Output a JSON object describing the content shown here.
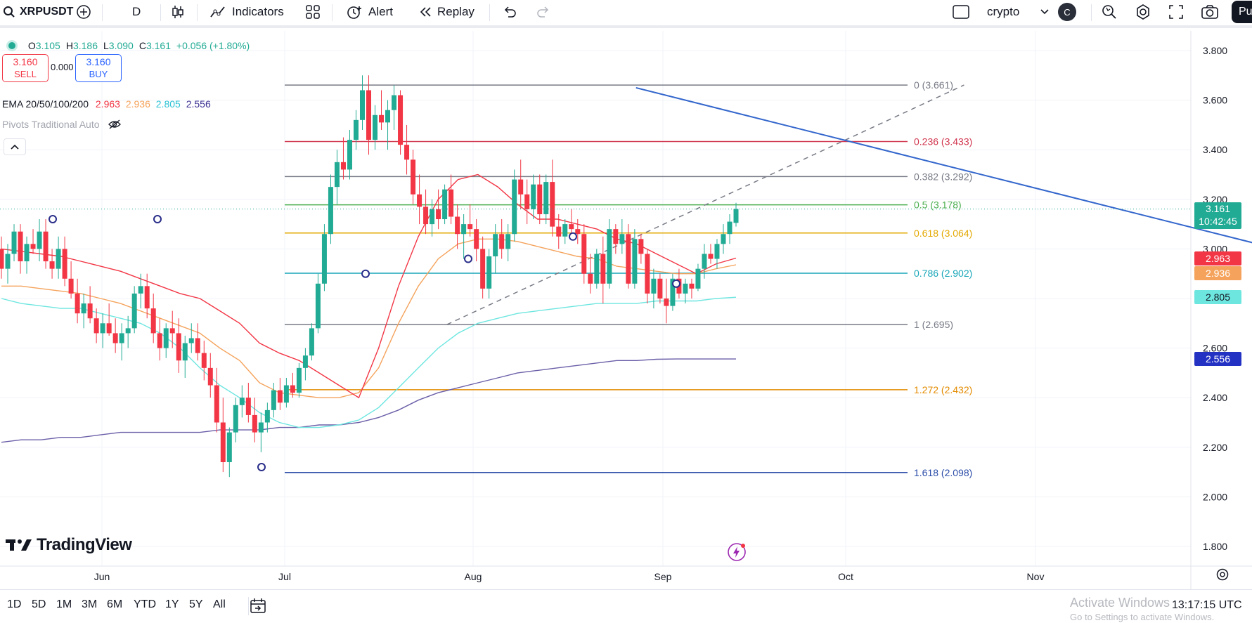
{
  "toolbar": {
    "symbol": "XRPUSDT",
    "interval": "D",
    "indicators_label": "Indicators",
    "alert_label": "Alert",
    "replay_label": "Replay",
    "watchlist": "crypto",
    "avatar_letter": "C",
    "publish_label": "Pu"
  },
  "legend": {
    "ohlc": [
      {
        "key": "O",
        "value": "3.105"
      },
      {
        "key": "H",
        "value": "3.186"
      },
      {
        "key": "L",
        "value": "3.090"
      },
      {
        "key": "C",
        "value": "3.161"
      }
    ],
    "change": "+0.056 (+1.80%)",
    "sell_price": "3.160",
    "sell_label": "SELL",
    "spread": "0.000",
    "buy_price": "3.160",
    "buy_label": "BUY",
    "ema_label": "EMA 20/50/100/200",
    "ema_values": [
      "2.963",
      "2.936",
      "2.805",
      "2.556"
    ],
    "pivots_label": "Pivots Traditional Auto"
  },
  "colors": {
    "up": "#22ab94",
    "down": "#f23645",
    "ema20": "#f23645",
    "ema50": "#f5a35c",
    "ema100": "#6ee6e0",
    "ema200": "#6b5fa8",
    "trend": "#3366cc"
  },
  "price_axis": {
    "ticks": [
      "3.800",
      "3.600",
      "3.400",
      "3.200",
      "3.000",
      "2.800",
      "2.600",
      "2.400",
      "2.200",
      "2.000",
      "1.800"
    ],
    "last_price": "3.161",
    "countdown": "10:42:45",
    "ema_tags": [
      "2.963",
      "2.936",
      "2.805",
      "2.556"
    ]
  },
  "time_axis": [
    "Jun",
    "Jul",
    "Aug",
    "Sep",
    "Oct",
    "Nov"
  ],
  "fib_levels": [
    {
      "label": "0 (3.661)",
      "price": 3.661,
      "color": "#787b86"
    },
    {
      "label": "0.236 (3.433)",
      "price": 3.433,
      "color": "#d1364f"
    },
    {
      "label": "0.382 (3.292)",
      "price": 3.292,
      "color": "#787b86"
    },
    {
      "label": "0.5 (3.178)",
      "price": 3.178,
      "color": "#4caf50"
    },
    {
      "label": "0.618 (3.064)",
      "price": 3.064,
      "color": "#e3a800"
    },
    {
      "label": "0.786 (2.902)",
      "price": 2.902,
      "color": "#18a6b8"
    },
    {
      "label": "1 (2.695)",
      "price": 2.695,
      "color": "#787b86"
    },
    {
      "label": "1.272 (2.432)",
      "price": 2.432,
      "color": "#e38b00"
    },
    {
      "label": "1.618 (2.098)",
      "price": 2.098,
      "color": "#2c4da8"
    }
  ],
  "branding": "TradingView",
  "bottom": {
    "ranges": [
      "1D",
      "5D",
      "1M",
      "3M",
      "6M",
      "YTD",
      "1Y",
      "5Y",
      "All"
    ],
    "clock": "13:17:15 UTC",
    "watermark_title": "Activate Windows",
    "watermark_sub": "Go to Settings to activate Windows."
  },
  "chart_data": {
    "type": "candlestick",
    "price_range": [
      1.75,
      3.85
    ],
    "candles": [
      [
        3.0,
        3.05,
        2.88,
        2.92
      ],
      [
        2.92,
        3.02,
        2.86,
        2.98
      ],
      [
        2.98,
        3.1,
        2.95,
        3.07
      ],
      [
        3.07,
        3.1,
        2.9,
        2.95
      ],
      [
        2.95,
        3.05,
        2.9,
        3.02
      ],
      [
        3.02,
        3.08,
        2.98,
        3.0
      ],
      [
        3.0,
        3.12,
        2.95,
        3.07
      ],
      [
        3.07,
        3.12,
        2.92,
        2.95
      ],
      [
        2.95,
        3.0,
        2.88,
        2.92
      ],
      [
        2.92,
        3.05,
        2.88,
        3.0
      ],
      [
        3.0,
        3.05,
        2.85,
        2.88
      ],
      [
        2.88,
        2.95,
        2.8,
        2.82
      ],
      [
        2.82,
        2.88,
        2.7,
        2.74
      ],
      [
        2.74,
        2.82,
        2.68,
        2.78
      ],
      [
        2.78,
        2.85,
        2.7,
        2.72
      ],
      [
        2.72,
        2.76,
        2.62,
        2.66
      ],
      [
        2.66,
        2.74,
        2.6,
        2.7
      ],
      [
        2.7,
        2.78,
        2.65,
        2.66
      ],
      [
        2.66,
        2.72,
        2.58,
        2.62
      ],
      [
        2.62,
        2.7,
        2.55,
        2.66
      ],
      [
        2.66,
        2.73,
        2.6,
        2.68
      ],
      [
        2.68,
        2.85,
        2.66,
        2.82
      ],
      [
        2.82,
        2.9,
        2.76,
        2.85
      ],
      [
        2.85,
        2.9,
        2.72,
        2.76
      ],
      [
        2.76,
        2.82,
        2.62,
        2.66
      ],
      [
        2.66,
        2.72,
        2.55,
        2.6
      ],
      [
        2.6,
        2.7,
        2.56,
        2.68
      ],
      [
        2.68,
        2.75,
        2.6,
        2.66
      ],
      [
        2.66,
        2.72,
        2.5,
        2.55
      ],
      [
        2.55,
        2.65,
        2.48,
        2.62
      ],
      [
        2.62,
        2.7,
        2.58,
        2.64
      ],
      [
        2.64,
        2.7,
        2.55,
        2.58
      ],
      [
        2.58,
        2.63,
        2.47,
        2.52
      ],
      [
        2.52,
        2.58,
        2.4,
        2.45
      ],
      [
        2.45,
        2.52,
        2.26,
        2.3
      ],
      [
        2.3,
        2.4,
        2.1,
        2.14
      ],
      [
        2.14,
        2.28,
        2.08,
        2.26
      ],
      [
        2.26,
        2.4,
        2.22,
        2.37
      ],
      [
        2.37,
        2.45,
        2.32,
        2.4
      ],
      [
        2.4,
        2.46,
        2.3,
        2.33
      ],
      [
        2.33,
        2.4,
        2.22,
        2.26
      ],
      [
        2.26,
        2.34,
        2.18,
        2.3
      ],
      [
        2.3,
        2.38,
        2.26,
        2.35
      ],
      [
        2.35,
        2.46,
        2.32,
        2.43
      ],
      [
        2.43,
        2.48,
        2.35,
        2.38
      ],
      [
        2.38,
        2.48,
        2.36,
        2.45
      ],
      [
        2.45,
        2.5,
        2.4,
        2.42
      ],
      [
        2.42,
        2.54,
        2.4,
        2.52
      ],
      [
        2.52,
        2.6,
        2.47,
        2.57
      ],
      [
        2.57,
        2.7,
        2.55,
        2.68
      ],
      [
        2.68,
        2.9,
        2.66,
        2.86
      ],
      [
        2.86,
        3.1,
        2.83,
        3.06
      ],
      [
        3.06,
        3.3,
        3.02,
        3.25
      ],
      [
        3.25,
        3.4,
        3.18,
        3.35
      ],
      [
        3.35,
        3.45,
        3.28,
        3.32
      ],
      [
        3.32,
        3.48,
        3.28,
        3.44
      ],
      [
        3.44,
        3.56,
        3.4,
        3.52
      ],
      [
        3.52,
        3.7,
        3.48,
        3.64
      ],
      [
        3.64,
        3.7,
        3.38,
        3.44
      ],
      [
        3.44,
        3.58,
        3.4,
        3.54
      ],
      [
        3.54,
        3.64,
        3.48,
        3.51
      ],
      [
        3.51,
        3.6,
        3.4,
        3.56
      ],
      [
        3.56,
        3.66,
        3.48,
        3.62
      ],
      [
        3.62,
        3.64,
        3.38,
        3.42
      ],
      [
        3.42,
        3.5,
        3.3,
        3.36
      ],
      [
        3.36,
        3.4,
        3.18,
        3.22
      ],
      [
        3.22,
        3.3,
        3.1,
        3.17
      ],
      [
        3.17,
        3.24,
        3.06,
        3.1
      ],
      [
        3.1,
        3.2,
        3.05,
        3.16
      ],
      [
        3.16,
        3.24,
        3.08,
        3.12
      ],
      [
        3.12,
        3.26,
        3.1,
        3.24
      ],
      [
        3.24,
        3.3,
        3.1,
        3.13
      ],
      [
        3.13,
        3.18,
        3.0,
        3.06
      ],
      [
        3.06,
        3.14,
        2.96,
        3.1
      ],
      [
        3.1,
        3.18,
        3.05,
        3.08
      ],
      [
        3.08,
        3.12,
        2.95,
        3.0
      ],
      [
        3.0,
        3.05,
        2.8,
        2.84
      ],
      [
        2.84,
        3.0,
        2.8,
        2.97
      ],
      [
        2.97,
        3.1,
        2.9,
        3.06
      ],
      [
        3.06,
        3.12,
        2.96,
        3.0
      ],
      [
        3.0,
        3.1,
        2.95,
        3.06
      ],
      [
        3.06,
        3.32,
        3.03,
        3.28
      ],
      [
        3.28,
        3.36,
        3.16,
        3.22
      ],
      [
        3.22,
        3.28,
        3.1,
        3.16
      ],
      [
        3.16,
        3.3,
        3.12,
        3.26
      ],
      [
        3.26,
        3.3,
        3.1,
        3.14
      ],
      [
        3.14,
        3.3,
        3.1,
        3.27
      ],
      [
        3.27,
        3.36,
        3.05,
        3.09
      ],
      [
        3.09,
        3.14,
        3.0,
        3.05
      ],
      [
        3.05,
        3.12,
        3.02,
        3.1
      ],
      [
        3.1,
        3.16,
        3.04,
        3.08
      ],
      [
        3.08,
        3.12,
        3.02,
        3.06
      ],
      [
        3.06,
        3.1,
        2.86,
        2.9
      ],
      [
        2.9,
        2.98,
        2.82,
        2.86
      ],
      [
        2.86,
        3.0,
        2.84,
        2.98
      ],
      [
        2.98,
        3.05,
        2.78,
        2.86
      ],
      [
        2.86,
        3.12,
        2.84,
        3.08
      ],
      [
        3.08,
        3.1,
        2.98,
        3.02
      ],
      [
        3.02,
        3.12,
        2.98,
        3.06
      ],
      [
        3.06,
        3.1,
        2.84,
        2.86
      ],
      [
        2.86,
        3.08,
        2.84,
        3.04
      ],
      [
        3.04,
        3.06,
        2.94,
        2.98
      ],
      [
        2.98,
        3.0,
        2.78,
        2.82
      ],
      [
        2.82,
        2.92,
        2.76,
        2.88
      ],
      [
        2.88,
        2.9,
        2.78,
        2.8
      ],
      [
        2.8,
        2.88,
        2.7,
        2.77
      ],
      [
        2.77,
        2.9,
        2.75,
        2.88
      ],
      [
        2.88,
        2.92,
        2.8,
        2.82
      ],
      [
        2.82,
        2.88,
        2.78,
        2.86
      ],
      [
        2.86,
        2.88,
        2.8,
        2.84
      ],
      [
        2.84,
        2.94,
        2.83,
        2.92
      ],
      [
        2.92,
        3.02,
        2.88,
        2.98
      ],
      [
        2.98,
        3.02,
        2.94,
        2.96
      ],
      [
        2.96,
        3.04,
        2.92,
        3.02
      ],
      [
        3.02,
        3.1,
        2.98,
        3.06
      ],
      [
        3.06,
        3.14,
        3.02,
        3.11
      ],
      [
        3.105,
        3.186,
        3.09,
        3.161
      ]
    ],
    "ema20": [
      3.0,
      2.99,
      2.98,
      2.97,
      2.95,
      2.93,
      2.91,
      2.88,
      2.85,
      2.82,
      2.8,
      2.75,
      2.7,
      2.62,
      2.58,
      2.55,
      2.5,
      2.45,
      2.4,
      2.6,
      2.85,
      3.05,
      3.2,
      3.28,
      3.3,
      3.25,
      3.18,
      3.12,
      3.12,
      3.1,
      3.08,
      3.04,
      3.02,
      2.98,
      2.94,
      2.9,
      2.94,
      2.963
    ],
    "ema50": [
      2.85,
      2.85,
      2.84,
      2.83,
      2.82,
      2.8,
      2.78,
      2.75,
      2.72,
      2.69,
      2.66,
      2.6,
      2.55,
      2.46,
      2.42,
      2.41,
      2.4,
      2.4,
      2.42,
      2.52,
      2.7,
      2.85,
      2.96,
      3.02,
      3.04,
      3.04,
      3.03,
      3.01,
      2.99,
      2.97,
      2.96,
      2.93,
      2.92,
      2.91,
      2.9,
      2.9,
      2.92,
      2.936
    ],
    "ema100": [
      2.8,
      2.78,
      2.77,
      2.76,
      2.76,
      2.74,
      2.72,
      2.7,
      2.66,
      2.6,
      2.52,
      2.45,
      2.4,
      2.34,
      2.3,
      2.28,
      2.28,
      2.29,
      2.31,
      2.36,
      2.44,
      2.52,
      2.6,
      2.66,
      2.7,
      2.72,
      2.74,
      2.75,
      2.76,
      2.77,
      2.78,
      2.78,
      2.78,
      2.79,
      2.79,
      2.79,
      2.8,
      2.805
    ],
    "ema200": [
      2.22,
      2.23,
      2.23,
      2.24,
      2.24,
      2.25,
      2.26,
      2.26,
      2.26,
      2.26,
      2.26,
      2.27,
      2.27,
      2.27,
      2.28,
      2.28,
      2.29,
      2.29,
      2.3,
      2.32,
      2.35,
      2.39,
      2.42,
      2.44,
      2.46,
      2.48,
      2.5,
      2.51,
      2.52,
      2.53,
      2.54,
      2.55,
      2.55,
      2.555,
      2.556,
      2.556,
      2.556,
      2.556
    ],
    "trendline": [
      [
        0.508,
        3.65
      ],
      [
        0.815,
        2.79
      ]
    ],
    "fib_diagonal": [
      [
        0.357,
        2.695
      ],
      [
        0.77,
        3.661
      ]
    ]
  }
}
